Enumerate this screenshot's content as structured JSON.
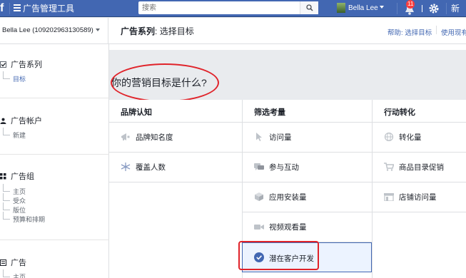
{
  "topbar": {
    "logo": "f",
    "app_title": "广告管理工具",
    "search_placeholder": "搜索",
    "user_name": "Bella Lee",
    "notification_count": "11",
    "right_cut_text": "新"
  },
  "subheader": {
    "account_select": "Bella Lee (109202963130589)",
    "breadcrumb_strong": "广告系列",
    "breadcrumb_sep": ": ",
    "breadcrumb_rest": "选择目标",
    "help_link": "帮助: 选择目标",
    "use_link": "使用现有"
  },
  "sidebar": {
    "campaign": {
      "label": "广告系列",
      "child": "目标"
    },
    "account": {
      "label": "广告帐户",
      "child": "新建"
    },
    "adset": {
      "label": "广告组",
      "children": [
        "主页",
        "受众",
        "版位",
        "预算和排期"
      ]
    },
    "ad": {
      "label": "广告",
      "child": "主页"
    }
  },
  "main": {
    "question": "你的营销目标是什么?",
    "columns": [
      {
        "header": "品牌认知",
        "items": [
          {
            "label": "品牌知名度",
            "icon": "megaphone-icon"
          },
          {
            "label": "覆盖人数",
            "icon": "snowflake-icon"
          }
        ]
      },
      {
        "header": "筛选考量",
        "items": [
          {
            "label": "访问量",
            "icon": "cursor-icon"
          },
          {
            "label": "参与互动",
            "icon": "chat-bubbles-icon"
          },
          {
            "label": "应用安装量",
            "icon": "box-icon"
          },
          {
            "label": "视频观看量",
            "icon": "video-camera-icon"
          },
          {
            "label": "潜在客户开发",
            "icon": "check-circle-icon",
            "selected": true
          }
        ]
      },
      {
        "header": "行动转化",
        "items": [
          {
            "label": "转化量",
            "icon": "globe-icon"
          },
          {
            "label": "商品目录促销",
            "icon": "cart-icon"
          },
          {
            "label": "店铺访问量",
            "icon": "store-icon"
          }
        ]
      }
    ]
  },
  "colors": {
    "topbar_bg": "#4267b2",
    "link": "#4267b2",
    "annotation_red": "#e0232a",
    "selected_bg": "#ecf3ff"
  }
}
